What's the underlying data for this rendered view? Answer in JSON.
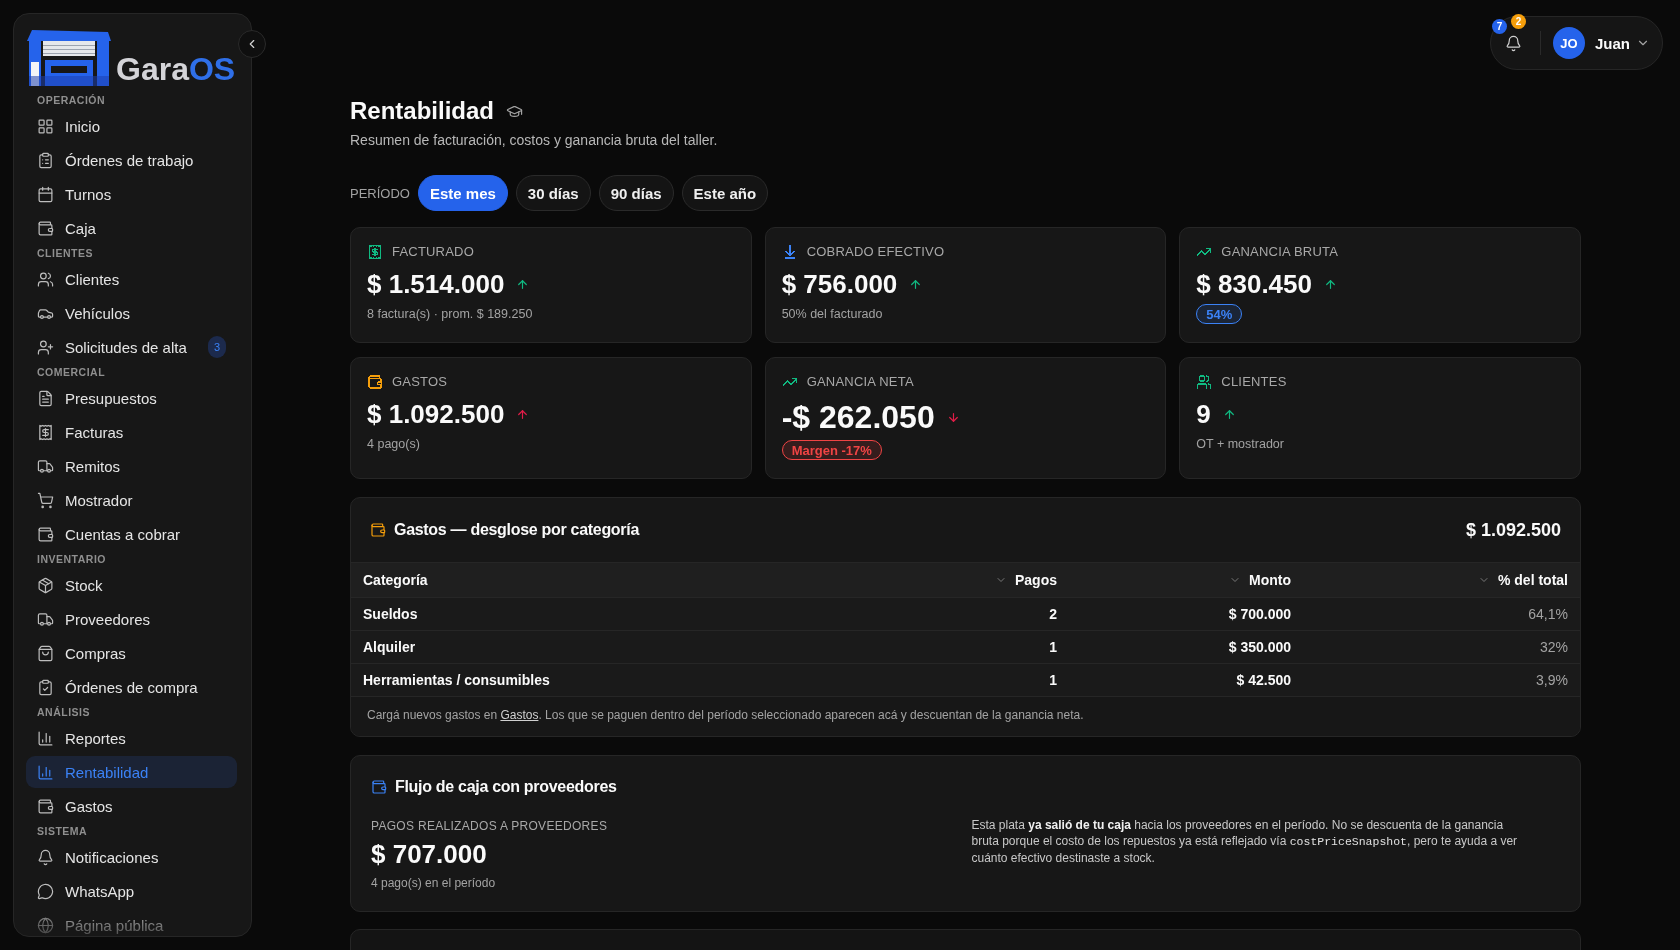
{
  "sidebar": {
    "logo": {
      "text": "Gara",
      "accent": "OS"
    },
    "sections": [
      {
        "label": "OPERACIÓN",
        "items": [
          {
            "label": "Inicio",
            "selected": false
          },
          {
            "label": "Órdenes de trabajo",
            "selected": false
          },
          {
            "label": "Turnos",
            "selected": false
          },
          {
            "label": "Caja",
            "selected": false
          }
        ]
      },
      {
        "label": "CLIENTES",
        "items": [
          {
            "label": "Clientes",
            "selected": false
          },
          {
            "label": "Vehículos",
            "selected": false
          },
          {
            "label": "Solicitudes de alta",
            "selected": false,
            "badge": "3"
          }
        ]
      },
      {
        "label": "COMERCIAL",
        "items": [
          {
            "label": "Presupuestos",
            "selected": false
          },
          {
            "label": "Facturas",
            "selected": false
          },
          {
            "label": "Remitos",
            "selected": false
          },
          {
            "label": "Mostrador",
            "selected": false
          },
          {
            "label": "Cuentas a cobrar",
            "selected": false
          }
        ]
      },
      {
        "label": "INVENTARIO",
        "items": [
          {
            "label": "Stock",
            "selected": false
          },
          {
            "label": "Proveedores",
            "selected": false
          },
          {
            "label": "Compras",
            "selected": false
          },
          {
            "label": "Órdenes de compra",
            "selected": false
          }
        ]
      },
      {
        "label": "ANÁLISIS",
        "items": [
          {
            "label": "Reportes",
            "selected": false
          },
          {
            "label": "Rentabilidad",
            "selected": true
          },
          {
            "label": "Gastos",
            "selected": false
          }
        ]
      },
      {
        "label": "SISTEMA",
        "items": [
          {
            "label": "Notificaciones",
            "selected": false
          },
          {
            "label": "WhatsApp",
            "selected": false
          },
          {
            "label": "Página pública",
            "selected": false
          }
        ]
      }
    ]
  },
  "topbar": {
    "notifications": [
      {
        "count": "7",
        "color": "#2563eb"
      },
      {
        "count": "2",
        "color": "#f59e0b"
      }
    ],
    "user": {
      "initials": "JO",
      "name": "Juan"
    }
  },
  "page": {
    "title": "Rentabilidad",
    "subtitle": "Resumen de facturación, costos y ganancia bruta del taller."
  },
  "period": {
    "label": "PERÍODO",
    "options": [
      {
        "label": "Este mes",
        "selected": true
      },
      {
        "label": "30 días",
        "selected": false
      },
      {
        "label": "90 días",
        "selected": false
      },
      {
        "label": "Este año",
        "selected": false
      }
    ]
  },
  "stats": [
    {
      "label": "FACTURADO",
      "color": "#10b981",
      "value": "$ 1.514.000",
      "emphasized": false,
      "trend": {
        "rising": true,
        "color": "#10b981"
      },
      "note": {
        "kind": "text",
        "text": "8 factura(s) · prom. $ 189.250"
      }
    },
    {
      "label": "COBRADO EFECTIVO",
      "color": "#3b82f6",
      "value": "$ 756.000",
      "emphasized": false,
      "trend": {
        "rising": true,
        "color": "#10b981"
      },
      "note": {
        "kind": "text",
        "text": "50% del facturado"
      }
    },
    {
      "label": "GANANCIA BRUTA",
      "color": "#10b981",
      "value": "$ 830.450",
      "emphasized": false,
      "trend": {
        "rising": true,
        "color": "#10b981"
      },
      "note": {
        "kind": "badge",
        "text": "54%",
        "color": "#3b82f6"
      }
    },
    {
      "label": "GASTOS",
      "color": "#f59e0b",
      "value": "$ 1.092.500",
      "emphasized": false,
      "trend": {
        "rising": true,
        "color": "#e11d48"
      },
      "note": {
        "kind": "text",
        "text": "4 pago(s)"
      }
    },
    {
      "label": "GANANCIA NETA",
      "color": "#10b981",
      "value": "-$ 262.050",
      "emphasized": true,
      "trend": {
        "rising": false,
        "color": "#e11d48"
      },
      "note": {
        "kind": "badge",
        "text": "Margen -17%",
        "color": "#ef4444"
      }
    },
    {
      "label": "CLIENTES",
      "color": "#10b981",
      "value": "9",
      "emphasized": false,
      "trend": {
        "rising": true,
        "color": "#10b981"
      },
      "note": {
        "kind": "text",
        "text": "OT + mostrador"
      }
    }
  ],
  "expenses": {
    "title": "Gastos — desglose por categoría",
    "total": "$ 1.092.500",
    "columns": [
      {
        "label": "Categoría",
        "sortable": false
      },
      {
        "label": "Pagos",
        "sortable": true
      },
      {
        "label": "Monto",
        "sortable": true
      },
      {
        "label": "% del total",
        "sortable": true
      }
    ],
    "rows": [
      [
        "Sueldos",
        "2",
        "$ 700.000",
        "64,1%"
      ],
      [
        "Alquiler",
        "1",
        "$ 350.000",
        "32%"
      ],
      [
        "Herramientas / consumibles",
        "1",
        "$ 42.500",
        "3,9%"
      ]
    ],
    "note": {
      "text_before": "Cargá nuevos gastos en ",
      "link": "Gastos",
      "text_after": ". Los que se paguen dentro del período seleccionado aparecen acá y descuentan de la ganancia neta."
    }
  },
  "supplier_cash_flow": {
    "title": "Flujo de caja con proveedores",
    "metric_label": "PAGOS REALIZADOS A PROVEEDORES",
    "value": "$ 707.000",
    "subtext": "4 pago(s) en el período",
    "explanation": {
      "text_before": "Esta plata **ya salió de tu caja** hacia los proveedores en el período. No se descuenta de la ganancia bruta porque el costo de los repuestos ya está reflejado vía ",
      "code": "costPriceSnapshot",
      "text_after": ", pero te ayuda a ver cuánto efectivo destinaste a stock."
    }
  }
}
